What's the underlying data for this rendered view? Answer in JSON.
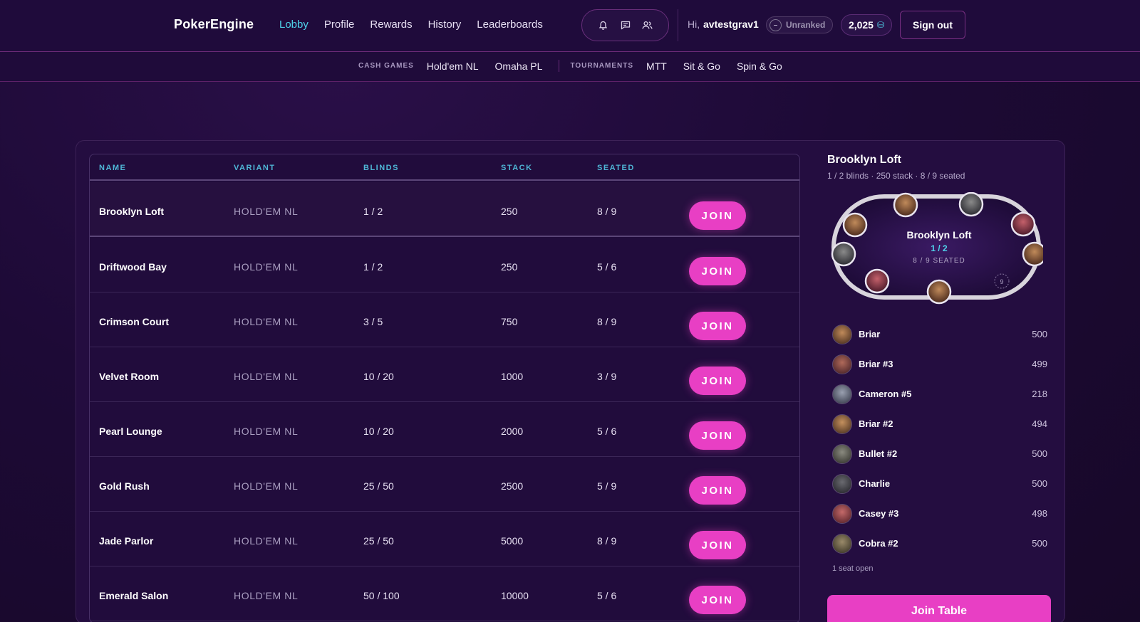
{
  "app": {
    "logo": "PokerEngine"
  },
  "nav": {
    "items": [
      "Lobby",
      "Profile",
      "Rewards",
      "History",
      "Leaderboards"
    ],
    "active": "Lobby"
  },
  "header": {
    "greeting": "Hi,",
    "username": "avtestgrav1",
    "rank": "Unranked",
    "rank_icon": "minus-circle-icon",
    "chips": "2,025",
    "chips_icon": "coin-stack-icon",
    "signout_label": "Sign out",
    "icons": [
      "bell-icon",
      "chat-icon",
      "friends-icon"
    ]
  },
  "subnav": {
    "cash_label": "CASH GAMES",
    "cash_items": [
      "Hold'em NL",
      "Omaha PL"
    ],
    "tournament_label": "TOURNAMENTS",
    "tournament_items": [
      "MTT",
      "Sit & Go",
      "Spin & Go"
    ]
  },
  "table": {
    "columns": [
      "NAME",
      "VARIANT",
      "BLINDS",
      "STACK",
      "SEATED"
    ],
    "join_label": "JOIN",
    "rows": [
      {
        "name": "Brooklyn Loft",
        "variant": "HOLD'EM NL",
        "blinds": "1 / 2",
        "stack": "250",
        "seated": "8 / 9"
      },
      {
        "name": "Driftwood Bay",
        "variant": "HOLD'EM NL",
        "blinds": "1 / 2",
        "stack": "250",
        "seated": "5 / 6"
      },
      {
        "name": "Crimson Court",
        "variant": "HOLD'EM NL",
        "blinds": "3 / 5",
        "stack": "750",
        "seated": "8 / 9"
      },
      {
        "name": "Velvet Room",
        "variant": "HOLD'EM NL",
        "blinds": "10 / 20",
        "stack": "1000",
        "seated": "3 / 9"
      },
      {
        "name": "Pearl Lounge",
        "variant": "HOLD'EM NL",
        "blinds": "10 / 20",
        "stack": "2000",
        "seated": "5 / 6"
      },
      {
        "name": "Gold Rush",
        "variant": "HOLD'EM NL",
        "blinds": "25 / 50",
        "stack": "2500",
        "seated": "5 / 9"
      },
      {
        "name": "Jade Parlor",
        "variant": "HOLD'EM NL",
        "blinds": "25 / 50",
        "stack": "5000",
        "seated": "8 / 9"
      },
      {
        "name": "Emerald Salon",
        "variant": "HOLD'EM NL",
        "blinds": "50 / 100",
        "stack": "10000",
        "seated": "5 / 6"
      }
    ]
  },
  "detail": {
    "title": "Brooklyn Loft",
    "subtitle": "1 / 2 blinds · 250 stack · 8 / 9 seated",
    "felt_name": "Brooklyn Loft",
    "felt_blinds": "1 / 2",
    "felt_seated": "8 / 9 SEATED",
    "empty_seat": "9",
    "players": [
      {
        "name": "Briar",
        "stack": "500"
      },
      {
        "name": "Briar #3",
        "stack": "499"
      },
      {
        "name": "Cameron #5",
        "stack": "218"
      },
      {
        "name": "Briar #2",
        "stack": "494"
      },
      {
        "name": "Bullet #2",
        "stack": "500"
      },
      {
        "name": "Charlie",
        "stack": "500"
      },
      {
        "name": "Casey #3",
        "stack": "498"
      },
      {
        "name": "Cobra #2",
        "stack": "500"
      }
    ],
    "seat_open": "1 seat open",
    "join_label": "Join Table"
  },
  "colors": {
    "accent": "#e83fc4",
    "link_active": "#4fd3ea",
    "background": "#1d0a36"
  }
}
